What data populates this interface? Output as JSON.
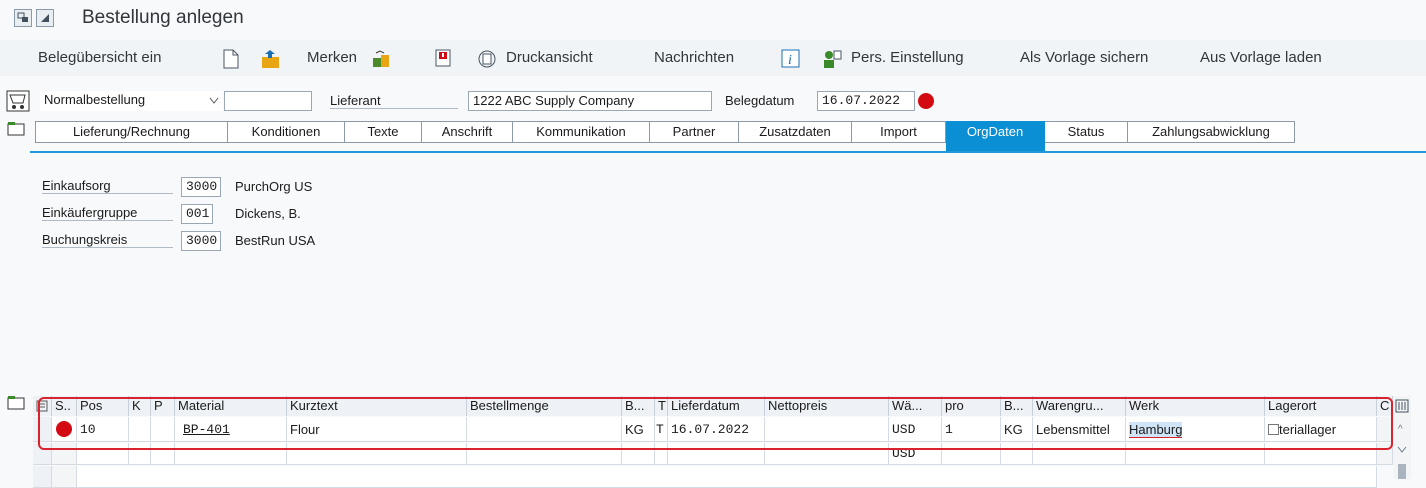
{
  "title": "Bestellung anlegen",
  "toolbar": {
    "beleguebersicht": "Belegübersicht ein",
    "merken": "Merken",
    "druckansicht": "Druckansicht",
    "nachrichten": "Nachrichten",
    "pers_einstellung": "Pers. Einstellung",
    "als_vorlage": "Als Vorlage sichern",
    "aus_vorlage": "Aus Vorlage laden"
  },
  "header": {
    "order_type": "Normalbestellung",
    "lieferant_label": "Lieferant",
    "lieferant_value": "1222 ABC Supply Company",
    "belegdatum_label": "Belegdatum",
    "belegdatum_value": "16.07.2022"
  },
  "tabs": [
    "Lieferung/Rechnung",
    "Konditionen",
    "Texte",
    "Anschrift",
    "Kommunikation",
    "Partner",
    "Zusatzdaten",
    "Import",
    "OrgDaten",
    "Status",
    "Zahlungsabwicklung"
  ],
  "active_tab": "OrgDaten",
  "orgdata": {
    "einkaufsorg_label": "Einkaufsorg",
    "einkaufsorg_code": "3000",
    "einkaufsorg_text": "PurchOrg US",
    "einkaeufergruppe_label": "Einkäufergruppe",
    "einkaeufergruppe_code": "001",
    "einkaeufergruppe_text": "Dickens, B.",
    "buchungskreis_label": "Buchungskreis",
    "buchungskreis_code": "3000",
    "buchungskreis_text": "BestRun USA"
  },
  "items": {
    "columns": [
      "S..",
      "Pos",
      "K",
      "P",
      "Material",
      "Kurztext",
      "Bestellmenge",
      "B...",
      "T",
      "Lieferdatum",
      "Nettopreis",
      "Wä...",
      "pro",
      "B...",
      "Warengru...",
      "Werk",
      "Lagerort",
      "C"
    ],
    "row1": {
      "pos": "10",
      "material": "BP-401",
      "kurztext": "Flour",
      "unit": "KG",
      "t": "T",
      "lieferdatum": "16.07.2022",
      "currency": "USD",
      "pro": "1",
      "pro_unit": "KG",
      "warengruppe": "Lebensmittel",
      "werk": "Hamburg",
      "lagerort": "teriallager"
    },
    "row2": {
      "currency": "USD"
    }
  },
  "colors": {
    "accent": "#0a8fd4",
    "error": "#d40a12",
    "highlight_border": "#d9232f"
  }
}
